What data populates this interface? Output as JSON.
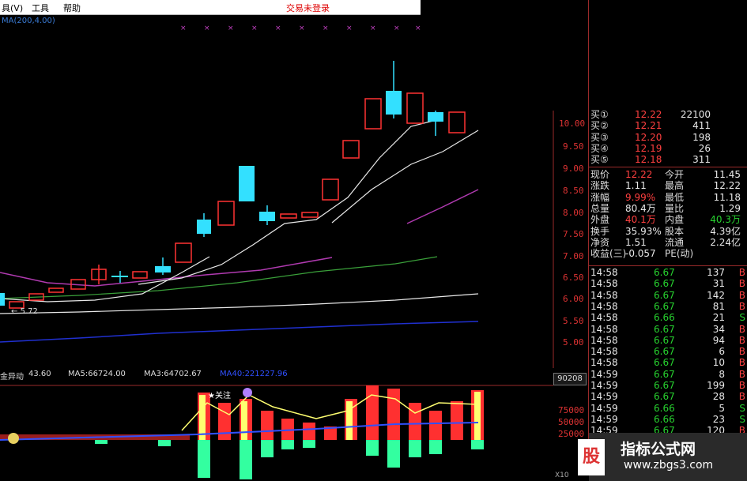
{
  "menubar": {
    "items": [
      "工具(V)",
      "工具",
      "帮助"
    ],
    "tools_label": "工具",
    "help_label": "帮助",
    "partial_label": "具(V)",
    "login_status": "交易未登录"
  },
  "main_chart": {
    "ma_label": "MA(200,4.00)",
    "price_axis_ticks": [
      "10.00",
      "9.50",
      "9.00",
      "8.50",
      "8.00",
      "7.50",
      "7.00",
      "6.50",
      "6.00",
      "5.50",
      "5.00"
    ],
    "low_marker": "5.72"
  },
  "indicator": {
    "name": "金异动",
    "name_value": "43.60",
    "ma5": "MA5:66724.00",
    "ma3": "MA3:64702.67",
    "ma40": "MA40:221227.96",
    "vol_box": "90208",
    "volume_ticks": [
      "75000",
      "50000",
      "25000"
    ],
    "focus_tag": "★关注",
    "x10": "X10"
  },
  "order_book": [
    {
      "label": "买①",
      "price": "12.22",
      "vol": "22100"
    },
    {
      "label": "买②",
      "price": "12.21",
      "vol": "411"
    },
    {
      "label": "买③",
      "price": "12.20",
      "vol": "198"
    },
    {
      "label": "买④",
      "price": "12.19",
      "vol": "26"
    },
    {
      "label": "买⑤",
      "price": "12.18",
      "vol": "311"
    }
  ],
  "quote": [
    {
      "l1": "现价",
      "v1": "12.22",
      "l2": "今开",
      "v2": "11.45"
    },
    {
      "l1": "涨跌",
      "v1": "1.11",
      "l2": "最高",
      "v2": "12.22"
    },
    {
      "l1": "涨幅",
      "v1": "9.99%",
      "l2": "最低",
      "v2": "11.18"
    },
    {
      "l1": "总量",
      "v1": "80.4万",
      "l2": "量比",
      "v2": "1.29"
    },
    {
      "l1": "外盘",
      "v1": "40.1万",
      "l2": "内盘",
      "v2": "40.3万"
    },
    {
      "l1": "换手",
      "v1": "35.93%",
      "l2": "股本",
      "v2": "4.39亿"
    },
    {
      "l1": "净资",
      "v1": "1.51",
      "l2": "流通",
      "v2": "2.24亿"
    },
    {
      "l1": "收益(三)",
      "v1": "-0.057",
      "l2": "PE(动)",
      "v2": ""
    }
  ],
  "ticks": [
    {
      "t": "14:58",
      "p": "6.67",
      "v": "137",
      "s": "B"
    },
    {
      "t": "14:58",
      "p": "6.67",
      "v": "31",
      "s": "B"
    },
    {
      "t": "14:58",
      "p": "6.67",
      "v": "142",
      "s": "B"
    },
    {
      "t": "14:58",
      "p": "6.67",
      "v": "81",
      "s": "B"
    },
    {
      "t": "14:58",
      "p": "6.66",
      "v": "21",
      "s": "S"
    },
    {
      "t": "14:58",
      "p": "6.67",
      "v": "34",
      "s": "B"
    },
    {
      "t": "14:58",
      "p": "6.67",
      "v": "94",
      "s": "B"
    },
    {
      "t": "14:58",
      "p": "6.67",
      "v": "6",
      "s": "B"
    },
    {
      "t": "14:58",
      "p": "6.67",
      "v": "10",
      "s": "B"
    },
    {
      "t": "14:59",
      "p": "6.67",
      "v": "8",
      "s": "B"
    },
    {
      "t": "14:59",
      "p": "6.67",
      "v": "199",
      "s": "B"
    },
    {
      "t": "14:59",
      "p": "6.67",
      "v": "28",
      "s": "B"
    },
    {
      "t": "14:59",
      "p": "6.66",
      "v": "5",
      "s": "S"
    },
    {
      "t": "14:59",
      "p": "6.66",
      "v": "23",
      "s": "S"
    },
    {
      "t": "14:59",
      "p": "6.67",
      "v": "120",
      "s": "B"
    }
  ],
  "watermark": {
    "title": "指标公式网",
    "url": "www.zbgs3.com",
    "mark": "股"
  },
  "colors": {
    "up": "#ff3333",
    "down": "#33e0ff",
    "ma_white": "#e8e8e8",
    "ma_magenta": "#b03ab0",
    "ma_green": "#3aa03a",
    "ma_blue": "#2030d0"
  }
}
